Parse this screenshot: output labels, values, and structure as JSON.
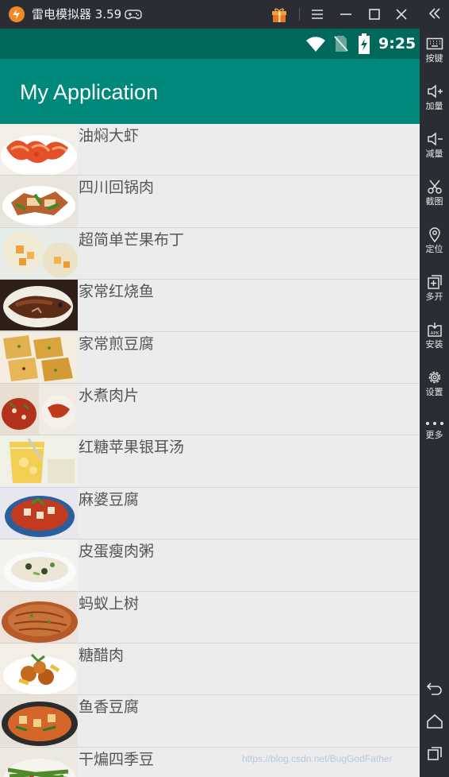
{
  "emulator": {
    "title": "雷电模拟器 3.59",
    "accent_color": "#f08a24",
    "toolbar": [
      {
        "icon": "keyboard-icon",
        "label": "按键"
      },
      {
        "icon": "volume-up-icon",
        "label": "加量"
      },
      {
        "icon": "volume-down-icon",
        "label": "减量"
      },
      {
        "icon": "scissors-icon",
        "label": "截图"
      },
      {
        "icon": "location-pin-icon",
        "label": "定位"
      },
      {
        "icon": "multi-open-icon",
        "label": "多开"
      },
      {
        "icon": "apk-install-icon",
        "label": "安装"
      },
      {
        "icon": "gear-icon",
        "label": "设置"
      },
      {
        "icon": "more-dots-icon",
        "label": "更多"
      }
    ],
    "nav_icons": [
      "back-icon",
      "home-icon",
      "recents-icon"
    ]
  },
  "status_bar": {
    "time": "9:25",
    "color": "#00695c"
  },
  "app_bar": {
    "title": "My Application",
    "color": "#00897b"
  },
  "recipes": [
    {
      "name": "油焖大虾"
    },
    {
      "name": "四川回锅肉"
    },
    {
      "name": "超简单芒果布丁"
    },
    {
      "name": "家常红烧鱼"
    },
    {
      "name": "家常煎豆腐"
    },
    {
      "name": "水煮肉片"
    },
    {
      "name": "红糖苹果银耳汤"
    },
    {
      "name": "麻婆豆腐"
    },
    {
      "name": "皮蛋瘦肉粥"
    },
    {
      "name": "蚂蚁上树"
    },
    {
      "name": "糖醋肉"
    },
    {
      "name": "鱼香豆腐"
    },
    {
      "name": "干煸四季豆"
    }
  ],
  "watermark": "https://blog.csdn.net/BugGodFather"
}
